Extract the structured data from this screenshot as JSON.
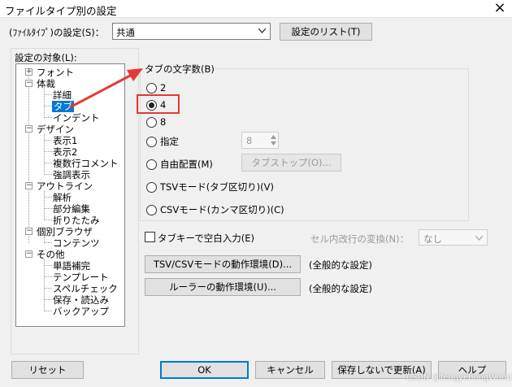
{
  "window": {
    "title": "ファイルタイプ別の設定",
    "close": "×"
  },
  "filetype": {
    "label": "(ﾌｧｲﾙﾀｲﾌﾟ)の設定(S)：",
    "value": "共通",
    "list_button": "設定のリスト(T)"
  },
  "tree": {
    "label": "設定の対象(L):",
    "items": [
      "フォント",
      "体裁",
      "詳細",
      "タブ",
      "インデント",
      "デザイン",
      "表示1",
      "表示2",
      "複数行コメント",
      "強調表示",
      "アウトライン",
      "解析",
      "部分編集",
      "折りたたみ",
      "個別ブラウザ",
      "コンテンツ",
      "その他",
      "単語補完",
      "テンプレート",
      "スペルチェック",
      "保存・読込み",
      "バックアップ"
    ]
  },
  "tab": {
    "group_label": "タブの文字数(B)",
    "opt2": "2",
    "opt4": "4",
    "opt8": "8",
    "opt_custom": "指定",
    "custom_value": "8",
    "opt_free": "自由配置(M)",
    "tabstop_button": "タブストップ(O)...",
    "opt_tsv": "TSVモード(タブ区切り)(V)",
    "opt_csv": "CSVモード(カンマ区切り)(C)"
  },
  "options": {
    "tabkey_label": "タブキーで空白入力(E)",
    "cell_newline_label": "セル内改行の変換(N)：",
    "cell_newline_value": "なし",
    "tsv_env_button": "TSV/CSVモードの動作環境(D)...",
    "tsv_env_note": "(全般的な設定)",
    "ruler_env_button": "ルーラーの動作環境(U)...",
    "ruler_env_note": "(全般的な設定)"
  },
  "footer": {
    "reset": "リセット",
    "ok": "OK",
    "cancel": "キャンセル",
    "update_nosave": "保存しないで更新(A)",
    "help": "ヘルプ"
  },
  "watermark": "CSDN @fengyehongWorld",
  "colors": {
    "highlight": "#e53935",
    "selection": "#0078d7"
  }
}
